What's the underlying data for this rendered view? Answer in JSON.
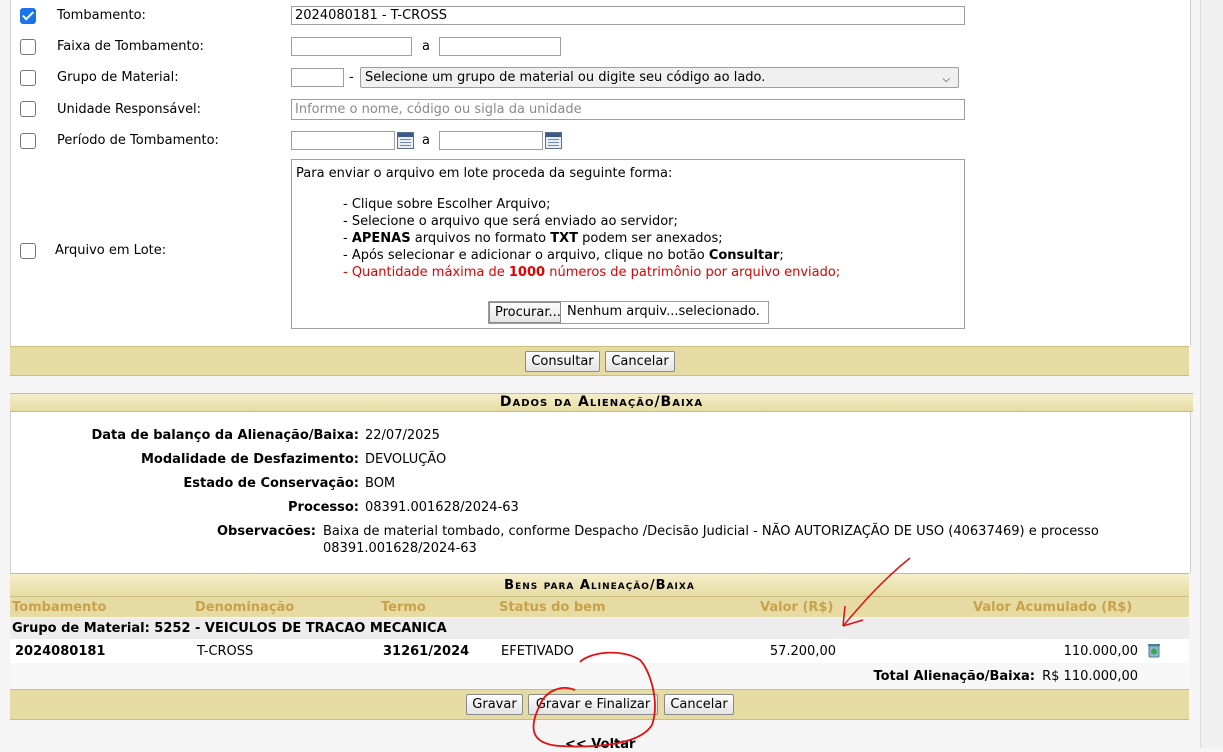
{
  "filters": {
    "tombamento": {
      "label": "Tombamento:",
      "value": "2024080181 - T-CROSS",
      "checked": true
    },
    "faixa": {
      "label": "Faixa de Tombamento:",
      "sep": "a",
      "from": "",
      "to": ""
    },
    "grupo": {
      "label": "Grupo de Material:",
      "dash": "-",
      "code": "",
      "select": "Selecione um grupo de material ou digite seu código ao lado."
    },
    "unidade": {
      "label": "Unidade Responsável:",
      "placeholder": "Informe o nome, código ou sigla da unidade"
    },
    "periodo": {
      "label": "Período de Tombamento:",
      "sep": "a",
      "from": "",
      "to": ""
    },
    "arquivo": {
      "label": "Arquivo em Lote:",
      "intro": "Para enviar o arquivo em lote proceda da seguinte forma:",
      "step1": "- Clique sobre Escolher Arquivo;",
      "step2": "- Selecione o arquivo que será enviado ao servidor;",
      "step3_pre": "- ",
      "step3_b1": "APENAS",
      "step3_mid": " arquivos no formato ",
      "step3_b2": "TXT",
      "step3_post": " podem ser anexados;",
      "step4_pre": "- Após selecionar e adicionar o arquivo, clique no botão ",
      "step4_b": "Consultar",
      "step4_post": ";",
      "step5_pre": "- Quantidade máxima de ",
      "step5_b": "1000",
      "step5_post": " números de patrimônio por arquivo enviado;",
      "browse": "Procurar...",
      "file_status": "Nenhum arquiv...selecionado."
    }
  },
  "filter_buttons": {
    "consultar": "Consultar",
    "cancelar": "Cancelar"
  },
  "dados": {
    "title": "Dados da Alienação/Baixa",
    "data_label": "Data de balanço da Alienação/Baixa:",
    "data_value": "22/07/2025",
    "modalidade_label": "Modalidade de Desfazimento:",
    "modalidade_value": "DEVOLUÇÃO",
    "estado_label": "Estado de Conservação:",
    "estado_value": "BOM",
    "processo_label": "Processo:",
    "processo_value": "08391.001628/2024-63",
    "obs_label": "Observacões:",
    "obs_line1": "Baixa de material tombado, conforme Despacho /Decisão Judicial - NÃO AUTORIZAÇÃO DE USO (40637469) e processo",
    "obs_line2": "08391.001628/2024-63"
  },
  "bens": {
    "title": "Bens para Alineação/Baixa",
    "headers": {
      "tombamento": "Tombamento",
      "denominacao": "Denominação",
      "termo": "Termo",
      "status": "Status do bem",
      "valor": "Valor (R$)",
      "acumulado": "Valor Acumulado (R$)"
    },
    "group": "Grupo de Material: 5252 - VEICULOS DE TRACAO MECANICA",
    "row": {
      "tombamento": "2024080181",
      "denominacao": "T-CROSS",
      "termo": "31261/2024",
      "status": "EFETIVADO",
      "valor": "57.200,00",
      "acumulado": "110.000,00"
    },
    "total_label": "Total Alienação/Baixa:",
    "total_value": "R$ 110.000,00"
  },
  "actions": {
    "gravar": "Gravar",
    "gravar_finalizar": "Gravar e Finalizar",
    "cancelar": "Cancelar"
  },
  "footer": {
    "voltar": "<< Voltar"
  },
  "colors": {
    "bar": "#e6dca3",
    "header_text": "#c9a14a",
    "annotation": "#e01010"
  }
}
